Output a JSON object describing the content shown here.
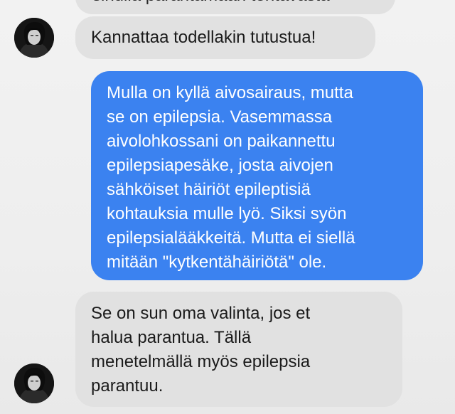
{
  "conversation": {
    "messages": [
      {
        "id": "msg-top-partial",
        "sender": "other",
        "lines": [
          "sinulla parantamaan tehtävästä"
        ]
      },
      {
        "id": "msg-1",
        "sender": "other",
        "lines": [
          "Kannattaa todellakin tutustua!"
        ]
      },
      {
        "id": "msg-2",
        "sender": "me",
        "lines": [
          "Mulla on kyllä aivosairaus, mutta",
          "se on epilepsia. Vasemmassa",
          "aivolohkossani on paikannettu",
          "epilepsiapesäke, josta aivojen",
          "sähköiset häiriöt epileptisiä",
          "kohtauksia mulle lyö. Siksi syön",
          "epilepsialääkkeitä. Mutta ei siellä",
          "mitään \"kytkentähäiriötä\" ole."
        ]
      },
      {
        "id": "msg-3",
        "sender": "other",
        "lines": [
          "Se on sun oma valinta, jos et",
          "halua parantua. Tällä",
          "menetelmällä myös epilepsia",
          "parantuu."
        ]
      }
    ]
  },
  "colors": {
    "outgoing_bubble": "#3b82f0",
    "incoming_bubble": "#e1e1e1",
    "background": "#f0f0f0"
  }
}
